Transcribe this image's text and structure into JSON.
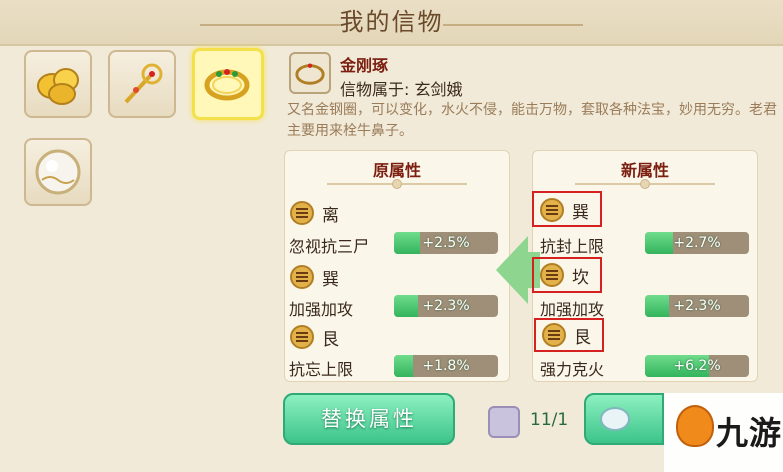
{
  "header": {
    "title": "我的信物"
  },
  "item": {
    "name": "金刚琢",
    "owner": "信物属于: 玄剑娥",
    "description": "又名金钢圈，可以变化，水火不侵，能击万物，套取各种法宝，妙用无穷。老君主要用来栓牛鼻子。"
  },
  "inventory": [
    {
      "icon": "gold-nuggets-icon",
      "selected": false
    },
    {
      "icon": "golden-scepter-icon",
      "selected": false
    },
    {
      "icon": "jeweled-ring-icon",
      "selected": true
    },
    {
      "icon": "pearl-orb-icon",
      "selected": false
    }
  ],
  "original": {
    "title": "原属性",
    "rows": [
      {
        "trigram": "离",
        "stat": "忽视抗三尸",
        "value_text": "+2.5%",
        "fill": 0.25
      },
      {
        "trigram": "巽",
        "stat": "加强加攻",
        "value_text": "+2.3%",
        "fill": 0.23
      },
      {
        "trigram": "艮",
        "stat": "抗忘上限",
        "value_text": "+1.8%",
        "fill": 0.18
      }
    ]
  },
  "new": {
    "title": "新属性",
    "rows": [
      {
        "trigram": "巽",
        "stat": "抗封上限",
        "value_text": "+2.7%",
        "fill": 0.27
      },
      {
        "trigram": "坎",
        "stat": "加强加攻",
        "value_text": "+2.3%",
        "fill": 0.23
      },
      {
        "trigram": "艮",
        "stat": "强力克火",
        "value_text": "+6.2%",
        "fill": 0.62
      }
    ]
  },
  "actions": {
    "replace_label": "替换属性",
    "cost_text": "11/1"
  },
  "watermark": {
    "text": "九游"
  },
  "colors": {
    "accent_green": "#3cc48a",
    "title_red": "#7b1f10",
    "highlight_red": "#d62121"
  }
}
